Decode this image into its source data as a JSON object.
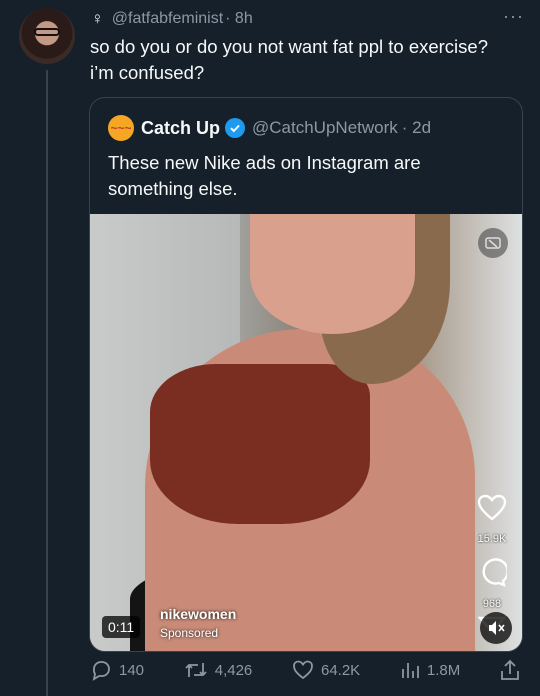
{
  "tweet": {
    "symbol": "♀",
    "handle": "@fatfabfeminist",
    "time": "· 8h",
    "text": "so do you or do you not want fat ppl to exercise? i’m confused?",
    "more": "···"
  },
  "quoted": {
    "name": "Catch Up",
    "handle": "@CatchUpNetwork",
    "time": "· 2d",
    "text": "These new Nike ads on Instagram are something else.",
    "logo_text": "~~~"
  },
  "media": {
    "like_count": "15.9K",
    "comment_count": "968",
    "brand": "nikewomen",
    "sponsored": "Sponsored",
    "duration": "0:11"
  },
  "actions": {
    "replies": "140",
    "retweets": "4,426",
    "likes": "64.2K",
    "views": "1.8M"
  },
  "colors": {
    "background": "#15202b",
    "border": "#38444d",
    "muted": "#8b98a5",
    "verified": "#1d9bf0",
    "bra": "#7a2e22"
  },
  "icons": [
    "venus-icon",
    "more-icon",
    "verified-icon",
    "gif-icon",
    "heart-icon",
    "comment-icon",
    "share-icon",
    "mute-icon",
    "reply-icon",
    "retweet-icon",
    "like-icon",
    "views-icon",
    "upload-icon"
  ]
}
